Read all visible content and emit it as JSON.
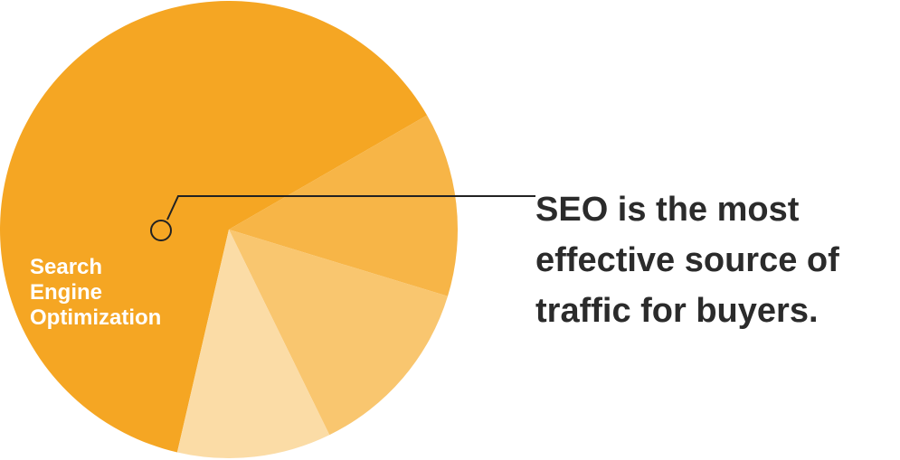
{
  "chart_data": {
    "type": "pie",
    "slices": [
      {
        "label": "Search Engine Optimization",
        "value": 58,
        "color": "#F5A623"
      },
      {
        "label": "",
        "value": 12,
        "color": "#F7B547"
      },
      {
        "label": "",
        "value": 12,
        "color": "#F9C66F"
      },
      {
        "label": "",
        "value": 10,
        "color": "#FBDCA6"
      }
    ],
    "label_lines": [
      "Search",
      "Engine",
      "Optimization"
    ],
    "callout": "SEO is the most effective source of traffic for buyers."
  }
}
